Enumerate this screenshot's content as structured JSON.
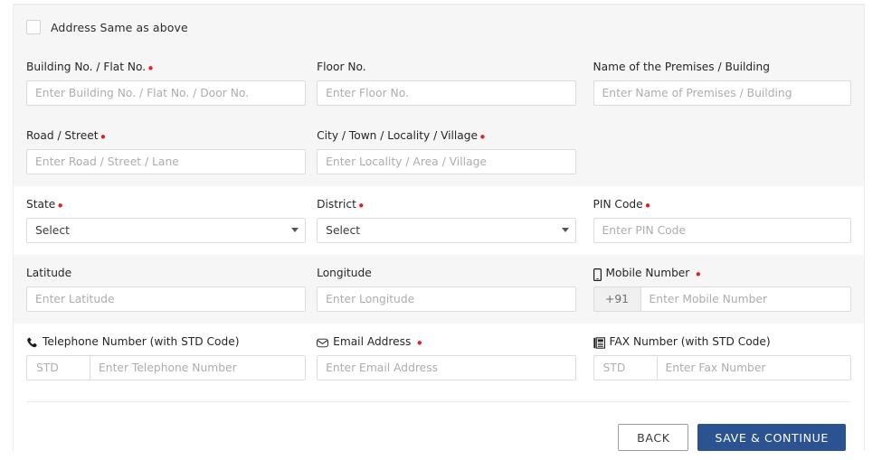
{
  "form": {
    "same_as_above": {
      "label": "Address Same as above",
      "checked": false
    },
    "rows": [
      {
        "shade": true,
        "fields": [
          {
            "label": "Building No. / Flat No.",
            "required": true,
            "placeholder": "Enter Building No. / Flat No. / Door No.",
            "value": "",
            "type": "text"
          },
          {
            "label": "Floor No.",
            "required": false,
            "placeholder": "Enter Floor No.",
            "value": "",
            "type": "text"
          },
          {
            "label": "Name of the Premises / Building",
            "required": false,
            "placeholder": "Enter Name of Premises / Building",
            "value": "",
            "type": "text"
          }
        ]
      },
      {
        "shade": true,
        "fields": [
          {
            "label": "Road / Street",
            "required": true,
            "placeholder": "Enter Road / Street / Lane",
            "value": "",
            "type": "text"
          },
          {
            "label": "City / Town / Locality / Village",
            "required": true,
            "placeholder": "Enter Locality / Area / Village",
            "value": "",
            "type": "text"
          },
          {
            "label": "",
            "required": false,
            "placeholder": "",
            "value": "",
            "type": "empty"
          }
        ]
      },
      {
        "shade": false,
        "fields": [
          {
            "label": "State",
            "required": true,
            "placeholder": "",
            "value": "Select",
            "type": "select"
          },
          {
            "label": "District",
            "required": true,
            "placeholder": "",
            "value": "Select",
            "type": "select"
          },
          {
            "label": "PIN Code",
            "required": true,
            "placeholder": "Enter PIN Code",
            "value": "",
            "type": "text"
          }
        ]
      },
      {
        "shade": true,
        "fields": [
          {
            "label": "Latitude",
            "required": false,
            "placeholder": "Enter Latitude",
            "value": "",
            "type": "text"
          },
          {
            "label": "Longitude",
            "required": false,
            "placeholder": "Enter Longitude",
            "value": "",
            "type": "text"
          },
          {
            "label": "Mobile Number",
            "required": true,
            "required_spaced": true,
            "icon": "mobile-icon",
            "prefix": "+91",
            "placeholder": "Enter Mobile Number",
            "value": "",
            "type": "prefix"
          }
        ]
      },
      {
        "shade": false,
        "fields": [
          {
            "label": "Telephone Number (with STD Code)",
            "required": false,
            "icon": "phone-icon",
            "prefix": "STD",
            "prefix_muted": true,
            "placeholder": "Enter Telephone Number",
            "value": "",
            "type": "prefix"
          },
          {
            "label": "Email Address",
            "required": true,
            "required_spaced": true,
            "icon": "envelope-icon",
            "placeholder": "Enter Email Address",
            "value": "",
            "type": "text"
          },
          {
            "label": "FAX Number (with STD Code)",
            "required": false,
            "icon": "fax-icon",
            "prefix": "STD",
            "prefix_muted": true,
            "placeholder": "Enter Fax Number",
            "value": "",
            "type": "prefix"
          }
        ]
      }
    ],
    "buttons": {
      "back": "BACK",
      "save": "SAVE & CONTINUE"
    }
  },
  "colors": {
    "primary": "#2b5392",
    "required": "#e02020",
    "shade": "#f6f6f6",
    "border": "#dcdcdc"
  }
}
